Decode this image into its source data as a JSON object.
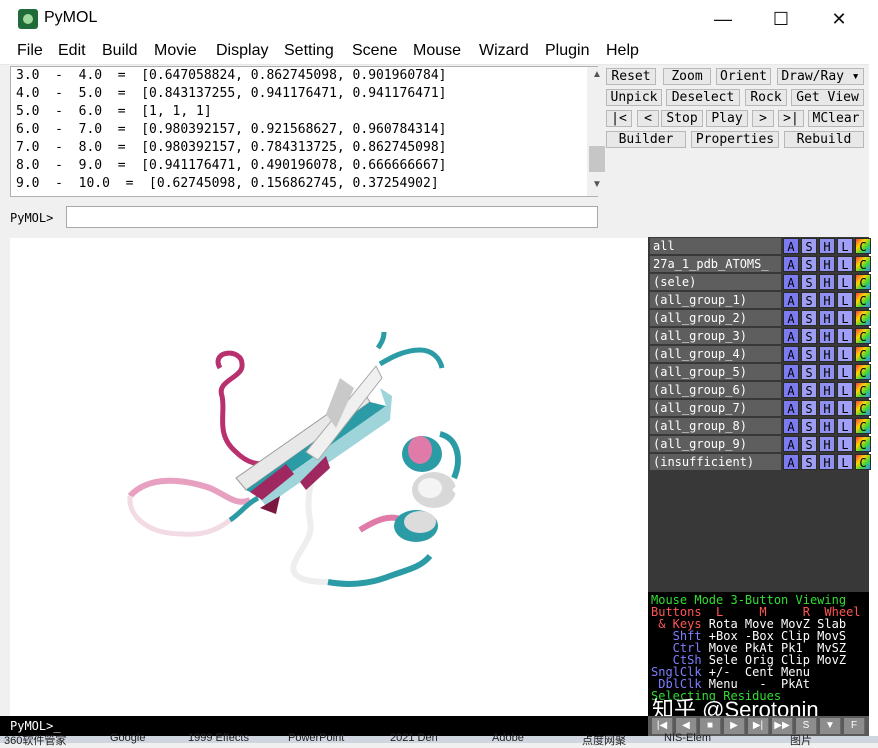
{
  "window": {
    "title": "PyMOL",
    "minimize": "—",
    "maximize": "☐",
    "close": "✕"
  },
  "menu": [
    "File",
    "Edit",
    "Build",
    "Movie",
    "Display",
    "Setting",
    "Scene",
    "Mouse",
    "Wizard",
    "Plugin",
    "Help"
  ],
  "output_lines": [
    "3.0  -  4.0  =  [0.647058824, 0.862745098, 0.901960784]",
    "4.0  -  5.0  =  [0.843137255, 0.941176471, 0.941176471]",
    "5.0  -  6.0  =  [1, 1, 1]",
    "6.0  -  7.0  =  [0.980392157, 0.921568627, 0.960784314]",
    "7.0  -  8.0  =  [0.980392157, 0.784313725, 0.862745098]",
    "8.0  -  9.0  =  [0.941176471, 0.490196078, 0.666666667]",
    "9.0  -  10.0  =  [0.62745098, 0.156862745, 0.37254902]"
  ],
  "command": {
    "prompt": "PyMOL>",
    "value": ""
  },
  "buttons": {
    "row1": [
      "Reset",
      "Zoom",
      "Orient",
      "Draw/Ray ▾"
    ],
    "row2": [
      "Unpick",
      "Deselect",
      "Rock",
      "Get View"
    ],
    "row3": [
      "|<",
      "<",
      "Stop",
      "Play",
      ">",
      ">|",
      "MClear"
    ],
    "row4": [
      "Builder",
      "Properties",
      "Rebuild"
    ]
  },
  "objects": [
    "all",
    "27a_1_pdb_ATOMS_",
    "(sele)",
    "(all_group_1)",
    "(all_group_2)",
    "(all_group_3)",
    "(all_group_4)",
    "(all_group_5)",
    "(all_group_6)",
    "(all_group_7)",
    "(all_group_8)",
    "(all_group_9)",
    "(insufficient)"
  ],
  "object_buttons": [
    "A",
    "S",
    "H",
    "L",
    "C"
  ],
  "mouse_mode": {
    "line1": [
      "Mouse Mode ",
      "3-Button Viewing"
    ],
    "line2": [
      "Buttons  L     M     R  Wheel"
    ],
    "line3": [
      " & Keys",
      " Rota Move MovZ Slab"
    ],
    "line4": [
      "   Shft",
      " +Box -Box Clip MovS"
    ],
    "line5": [
      "   Ctrl",
      " Move PkAt Pk1  MvSZ"
    ],
    "line6": [
      "   CtSh",
      " Sele Orig Clip MovZ"
    ],
    "line7": [
      "SnglClk",
      " +/-  Cent Menu"
    ],
    "line8": [
      " DblClk",
      " Menu   -  PkAt"
    ],
    "line9": [
      "Selecting Residues"
    ]
  },
  "status": "PyMOL>_",
  "watermark": "知乎 @Serotonin",
  "taskbar": [
    "360软件管家",
    "Google",
    "1999 Effects",
    "PowerPoint",
    "2021 Den",
    "Adobe",
    "点度网聚",
    "NIS-Elem",
    "图片"
  ],
  "colors": {
    "cyan": "#2b9ba6",
    "white": "#f2f2f2",
    "pink": "#e07aa8",
    "magenta": "#a02860"
  }
}
